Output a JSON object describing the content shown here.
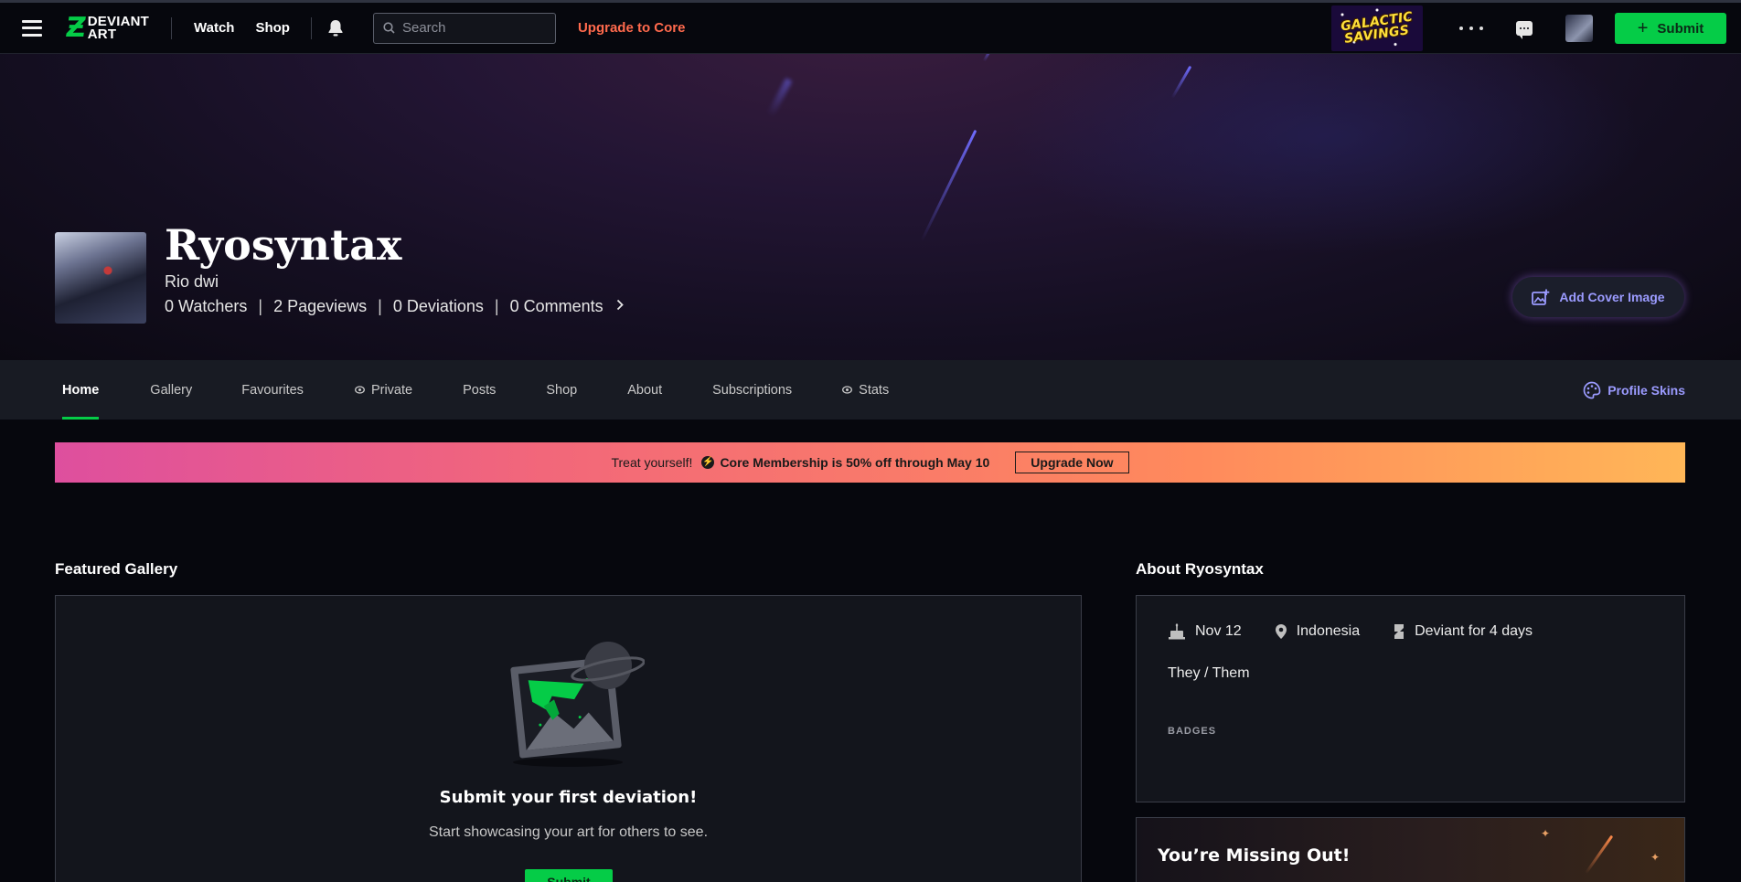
{
  "topbar": {
    "logo_text_line1": "DEVIANT",
    "logo_text_line2": "ART",
    "nav": {
      "watch": "Watch",
      "shop": "Shop"
    },
    "search_placeholder": "Search",
    "upgrade_link": "Upgrade to Core",
    "promo_badge": {
      "line1": "GALACTIC",
      "line2": "SAVINGS"
    },
    "submit_label": "Submit",
    "submit_icon": "plus-icon"
  },
  "profile": {
    "username": "Ryosyntax",
    "real_name": "Rio dwi",
    "stats": {
      "watchers": "0 Watchers",
      "pageviews": "2 Pageviews",
      "deviations": "0 Deviations",
      "comments": "0 Comments",
      "separator": "|"
    },
    "add_cover_label": "Add Cover Image"
  },
  "tabs": [
    {
      "label": "Home",
      "active": true
    },
    {
      "label": "Gallery"
    },
    {
      "label": "Favourites"
    },
    {
      "label": "Private",
      "icon": "eye-icon"
    },
    {
      "label": "Posts"
    },
    {
      "label": "Shop"
    },
    {
      "label": "About"
    },
    {
      "label": "Subscriptions"
    },
    {
      "label": "Stats",
      "icon": "eye-icon"
    }
  ],
  "profile_skins_label": "Profile Skins",
  "promo_strip": {
    "lead": "Treat yourself!",
    "offer": "Core Membership is 50% off through May 10",
    "button": "Upgrade Now"
  },
  "featured_gallery": {
    "title": "Featured Gallery",
    "empty_title": "Submit your first deviation!",
    "empty_subtitle": "Start showcasing your art for others to see.",
    "empty_button": "Submit"
  },
  "about": {
    "title": "About Ryosyntax",
    "birthday": "Nov 12",
    "location": "Indonesia",
    "member_for": "Deviant for 4 days",
    "pronouns": "They / Them",
    "badges_label": "BADGES"
  },
  "missing_out": {
    "title": "You’re Missing Out!"
  },
  "colors": {
    "accent_green": "#05cc47",
    "link_orange": "#ff6a4d",
    "link_purple": "#9b9bff",
    "background": "#06070d"
  }
}
